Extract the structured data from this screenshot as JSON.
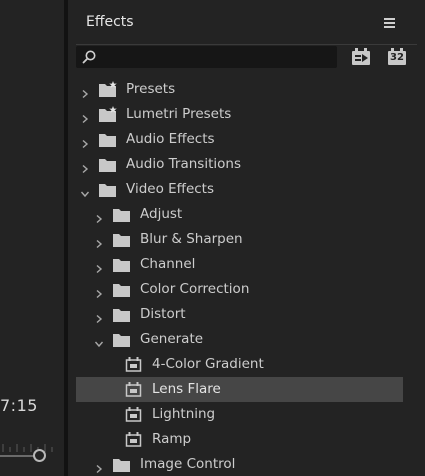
{
  "left_panel": {
    "timecode": "7:15"
  },
  "effects_panel": {
    "title": "Effects",
    "search": {
      "value": "",
      "placeholder": ""
    },
    "tools": [
      {
        "name": "accelerated-effects-icon"
      },
      {
        "name": "32-bit-effects-icon",
        "label": "32"
      }
    ],
    "tree": [
      {
        "label": "Presets",
        "level": 0,
        "icon": "preset-folder-icon",
        "state": "collapsed"
      },
      {
        "label": "Lumetri Presets",
        "level": 0,
        "icon": "preset-folder-icon",
        "state": "collapsed"
      },
      {
        "label": "Audio Effects",
        "level": 0,
        "icon": "folder-icon",
        "state": "collapsed"
      },
      {
        "label": "Audio Transitions",
        "level": 0,
        "icon": "folder-icon",
        "state": "collapsed"
      },
      {
        "label": "Video Effects",
        "level": 0,
        "icon": "folder-icon",
        "state": "expanded"
      },
      {
        "label": "Adjust",
        "level": 1,
        "icon": "folder-icon",
        "state": "collapsed"
      },
      {
        "label": "Blur & Sharpen",
        "level": 1,
        "icon": "folder-icon",
        "state": "collapsed"
      },
      {
        "label": "Channel",
        "level": 1,
        "icon": "folder-icon",
        "state": "collapsed"
      },
      {
        "label": "Color Correction",
        "level": 1,
        "icon": "folder-icon",
        "state": "collapsed"
      },
      {
        "label": "Distort",
        "level": 1,
        "icon": "folder-icon",
        "state": "collapsed"
      },
      {
        "label": "Generate",
        "level": 1,
        "icon": "folder-icon",
        "state": "expanded"
      },
      {
        "label": "4-Color Gradient",
        "level": 2,
        "icon": "effect-icon",
        "state": "leaf"
      },
      {
        "label": "Lens Flare",
        "level": 2,
        "icon": "effect-icon",
        "state": "leaf",
        "selected": true
      },
      {
        "label": "Lightning",
        "level": 2,
        "icon": "effect-icon",
        "state": "leaf"
      },
      {
        "label": "Ramp",
        "level": 2,
        "icon": "effect-icon",
        "state": "leaf"
      },
      {
        "label": "Image Control",
        "level": 1,
        "icon": "folder-icon",
        "state": "collapsed"
      }
    ]
  },
  "colors": {
    "panel_bg": "#232323",
    "search_bg": "#161616",
    "selected_row": "#464646",
    "text": "#cdcdcd",
    "icon": "#c8c8c8"
  }
}
